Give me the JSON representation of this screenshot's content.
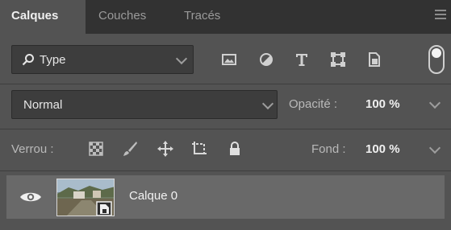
{
  "tabs": [
    {
      "label": "Calques",
      "active": true
    },
    {
      "label": "Couches",
      "active": false
    },
    {
      "label": "Tracés",
      "active": false
    }
  ],
  "filter": {
    "label": "Type",
    "icons": [
      "image-filter-icon",
      "adjustment-filter-icon",
      "type-filter-icon",
      "shape-filter-icon",
      "smart-object-filter-icon"
    ]
  },
  "blend": {
    "mode": "Normal",
    "opacity_label": "Opacité :",
    "opacity_value": "100 %"
  },
  "lock": {
    "label": "Verrou :",
    "fill_label": "Fond :",
    "fill_value": "100 %"
  },
  "layers": [
    {
      "name": "Calque 0",
      "visible": true
    }
  ],
  "colors": {
    "panel": "#535353",
    "tabbar": "#323232",
    "selected_layer": "#696969",
    "field": "#3d3d3d"
  }
}
